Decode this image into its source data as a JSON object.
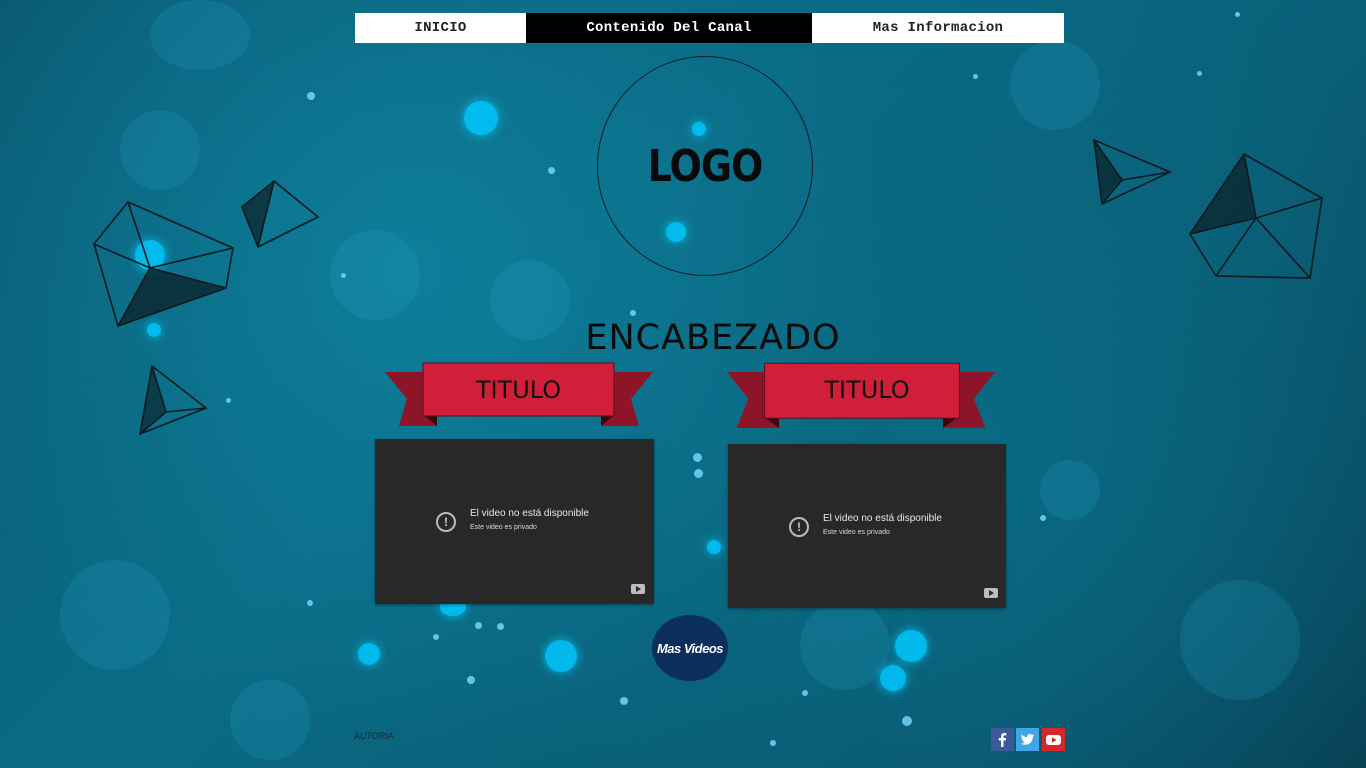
{
  "nav": {
    "items": [
      {
        "label": "INICIO"
      },
      {
        "label": "Contenido Del Canal"
      },
      {
        "label": "Mas Informacion"
      }
    ]
  },
  "logo": {
    "text": "LOGO"
  },
  "header": {
    "title": "ENCABEZADO"
  },
  "cards": [
    {
      "ribbon_label": "TITULO",
      "video": {
        "message": "El video no está disponible",
        "sub": "Este video es privado"
      }
    },
    {
      "ribbon_label": "TITULO",
      "video": {
        "message": "El video no está disponible",
        "sub": "Este video es privado"
      }
    }
  ],
  "more_button": {
    "label": "Mas Videos"
  },
  "footer": {
    "autoria": "AUTORIA",
    "social": [
      {
        "icon": "facebook-icon",
        "color": "#3b5998"
      },
      {
        "icon": "twitter-icon",
        "color": "#3fa6e8"
      },
      {
        "icon": "youtube-icon",
        "color": "#d8262d"
      }
    ]
  },
  "colors": {
    "ribbon_red": "#d11f3a",
    "ribbon_dark": "#8e1528",
    "video_bg": "#282828",
    "more_button_bg": "#0b2e5e"
  }
}
